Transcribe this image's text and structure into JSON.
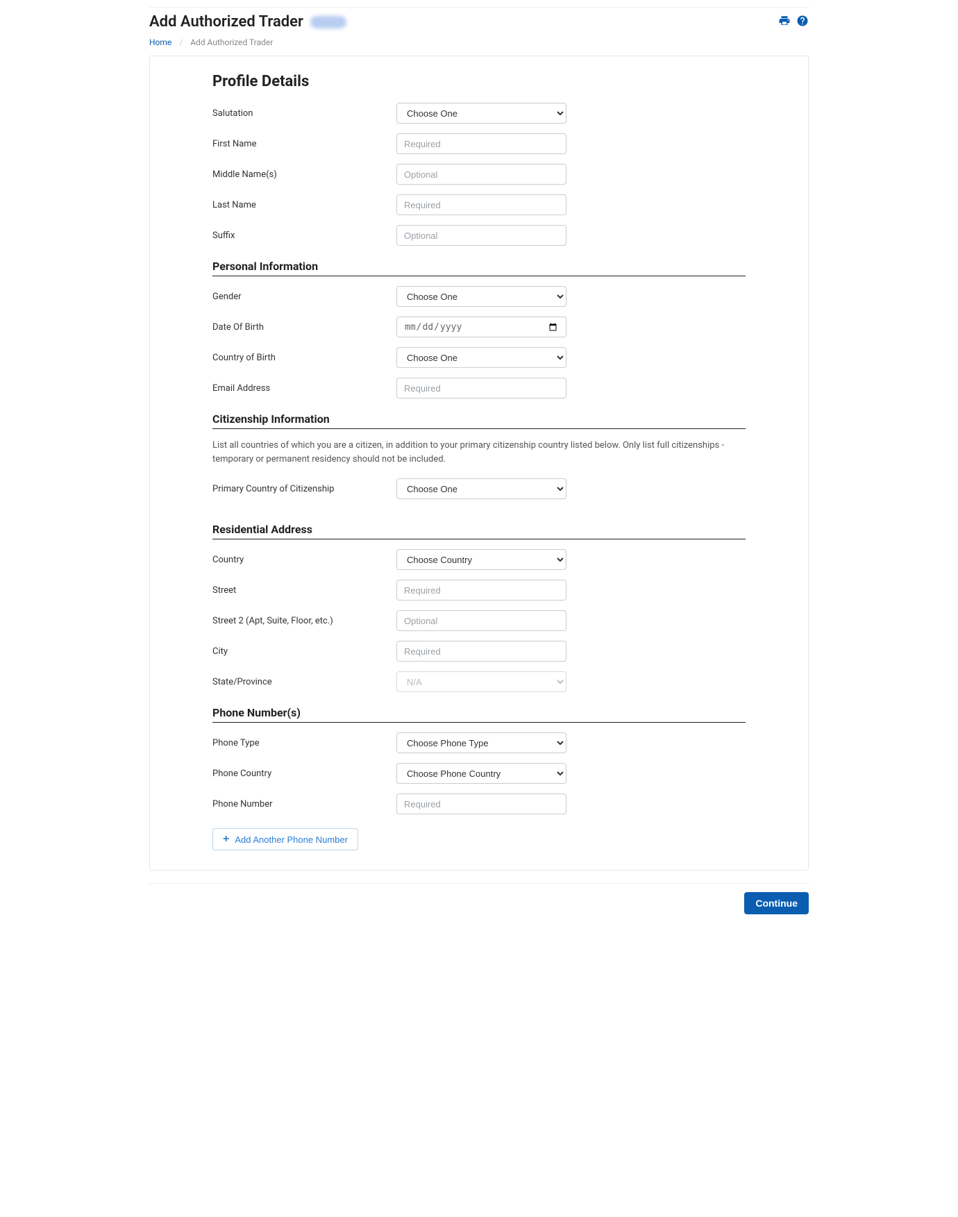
{
  "header": {
    "title": "Add Authorized Trader"
  },
  "breadcrumb": {
    "home": "Home",
    "current": "Add Authorized Trader"
  },
  "sections": {
    "profile": {
      "title": "Profile Details",
      "salutation_label": "Salutation",
      "salutation_selected": "Choose One",
      "first_name_label": "First Name",
      "first_name_placeholder": "Required",
      "middle_name_label": "Middle Name(s)",
      "middle_name_placeholder": "Optional",
      "last_name_label": "Last Name",
      "last_name_placeholder": "Required",
      "suffix_label": "Suffix",
      "suffix_placeholder": "Optional"
    },
    "personal": {
      "title": "Personal Information",
      "gender_label": "Gender",
      "gender_selected": "Choose One",
      "dob_label": "Date Of Birth",
      "dob_placeholder": "mm/dd/yyyy",
      "cob_label": "Country of Birth",
      "cob_selected": "Choose One",
      "email_label": "Email Address",
      "email_placeholder": "Required"
    },
    "citizenship": {
      "title": "Citizenship Information",
      "note": "List all countries of which you are a citizen, in addition to your primary citizenship country listed below. Only list full citizenships - temporary or permanent residency should not be included.",
      "primary_label": "Primary Country of Citizenship",
      "primary_selected": "Choose One"
    },
    "address": {
      "title": "Residential Address",
      "country_label": "Country",
      "country_selected": "Choose Country",
      "street_label": "Street",
      "street_placeholder": "Required",
      "street2_label": "Street 2 (Apt, Suite, Floor, etc.)",
      "street2_placeholder": "Optional",
      "city_label": "City",
      "city_placeholder": "Required",
      "state_label": "State/Province",
      "state_selected": "N/A"
    },
    "phone": {
      "title": "Phone Number(s)",
      "type_label": "Phone Type",
      "type_selected": "Choose Phone Type",
      "country_label": "Phone Country",
      "country_selected": "Choose Phone Country",
      "number_label": "Phone Number",
      "number_placeholder": "Required",
      "add_label": "Add Another Phone Number"
    }
  },
  "footer": {
    "continue": "Continue"
  }
}
